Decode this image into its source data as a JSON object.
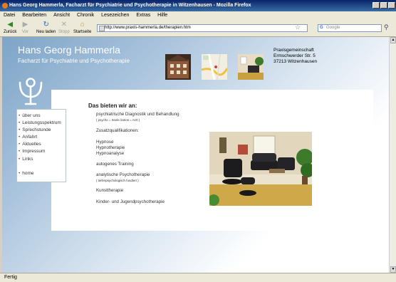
{
  "window": {
    "title": "Hans Georg Hammerla, Facharzt für Psychiatrie und Psychotherapie in Witzenhausen - Mozilla Firefox"
  },
  "menu": [
    "Datei",
    "Bearbeiten",
    "Ansicht",
    "Chronik",
    "Lesezeichen",
    "Extras",
    "Hilfe"
  ],
  "toolbar": {
    "back": "Zurück",
    "forward": "Vor",
    "reload": "Neu laden",
    "stop": "Stopp",
    "home": "Startseite",
    "url": "http://www.praxis-hammerla.de/therapien.htm",
    "search_placeholder": "Google"
  },
  "status": "Fertig",
  "site": {
    "title": "Hans Georg Hammerla",
    "subtitle": "Facharzt für Psychiatrie und Psychotherapie",
    "address": [
      "Praxisgemeinschaft",
      "Ermschwerder Str. 5",
      "37213 Witzenhausen"
    ]
  },
  "nav": [
    "über uns",
    "Leistungsspektrum",
    "Sprechstunde",
    "Anfahrt",
    "Aktuelles",
    "Impressum",
    "Links",
    "home"
  ],
  "content": {
    "heading": "Das bieten wir an:",
    "lines": [
      "psychiatrische Diagnostik und Behandlung",
      "( psycho = Seele  /iatros = Arzt )",
      "Zusatzqualifikationen:",
      "Hypnose",
      "Hypnotherapie",
      "Hypnoanalyse",
      "autogenes Training",
      "analytische Psychotherapie",
      "( tiefenpsychologisch fundiert )",
      "Kunsttherapie",
      "Kinder- und Jugendpsychotherapie"
    ]
  },
  "colors": {
    "title_bar": "#0a246a",
    "page_blue": "#7da4c7"
  }
}
